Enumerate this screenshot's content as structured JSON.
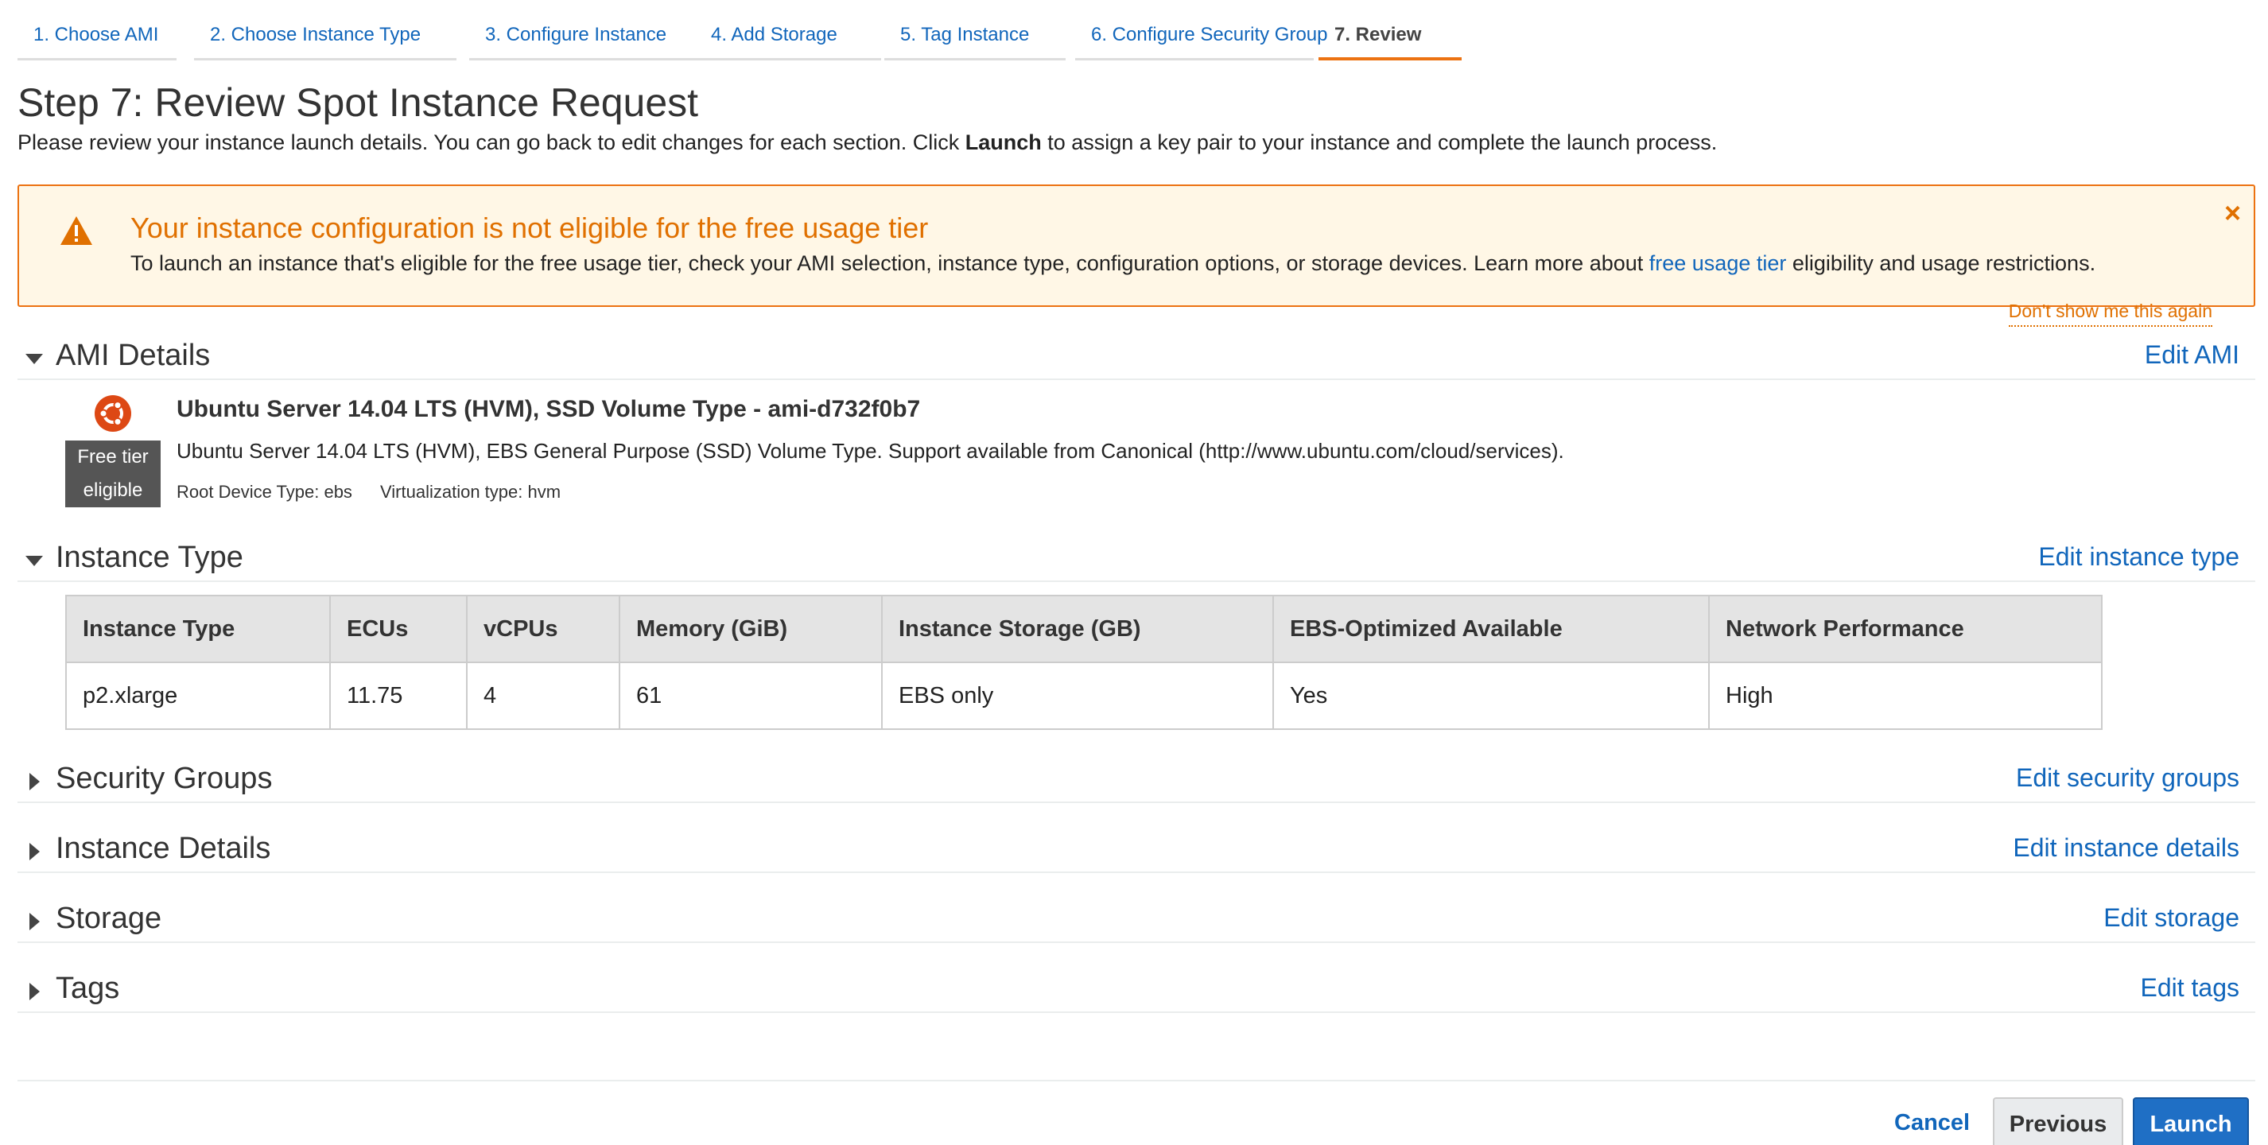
{
  "wizard": {
    "tabs": [
      {
        "label": "1. Choose AMI"
      },
      {
        "label": "2. Choose Instance Type"
      },
      {
        "label": "3. Configure Instance"
      },
      {
        "label": "4. Add Storage"
      },
      {
        "label": "5. Tag Instance"
      },
      {
        "label": "6. Configure Security Group"
      },
      {
        "label": "7. Review",
        "active": true
      }
    ]
  },
  "header": {
    "title": "Step 7: Review Spot Instance Request",
    "subtitle_before": "Please review your instance launch details. You can go back to edit changes for each section. Click ",
    "subtitle_bold": "Launch",
    "subtitle_after": " to assign a key pair to your instance and complete the launch process."
  },
  "warning": {
    "title": "Your instance configuration is not eligible for the free usage tier",
    "text_before": "To launch an instance that's eligible for the free usage tier, check your AMI selection, instance type, configuration options, or storage devices. Learn more about ",
    "link": "free usage tier",
    "text_after": " eligibility and usage restrictions.",
    "close": "×",
    "dont_show": "Don't show me this again",
    "color": "#ec7211"
  },
  "ami": {
    "section_title": "AMI Details",
    "edit_label": "Edit AMI",
    "name": "Ubuntu Server 14.04 LTS (HVM), SSD Volume Type - ami-d732f0b7",
    "description": "Ubuntu Server 14.04 LTS (HVM), EBS General Purpose (SSD) Volume Type. Support available from Canonical (http://www.ubuntu.com/cloud/services).",
    "root_device": "Root Device Type: ebs",
    "virtualization": "Virtualization type: hvm",
    "badge_line1": "Free tier",
    "badge_line2": "eligible",
    "icon": "ubuntu-logo-icon"
  },
  "instance_type": {
    "section_title": "Instance Type",
    "edit_label": "Edit instance type",
    "columns": [
      "Instance Type",
      "ECUs",
      "vCPUs",
      "Memory (GiB)",
      "Instance Storage (GB)",
      "EBS-Optimized Available",
      "Network Performance"
    ],
    "row": [
      "p2.xlarge",
      "11.75",
      "4",
      "61",
      "EBS only",
      "Yes",
      "High"
    ]
  },
  "sections": [
    {
      "title": "Security Groups",
      "edit": "Edit security groups"
    },
    {
      "title": "Instance Details",
      "edit": "Edit instance details"
    },
    {
      "title": "Storage",
      "edit": "Edit storage"
    },
    {
      "title": "Tags",
      "edit": "Edit tags"
    }
  ],
  "footer": {
    "cancel": "Cancel",
    "previous": "Previous",
    "launch": "Launch"
  },
  "colors": {
    "link": "#1166bb",
    "accent": "#ec7211",
    "primary_button": "#1f6fc5"
  }
}
